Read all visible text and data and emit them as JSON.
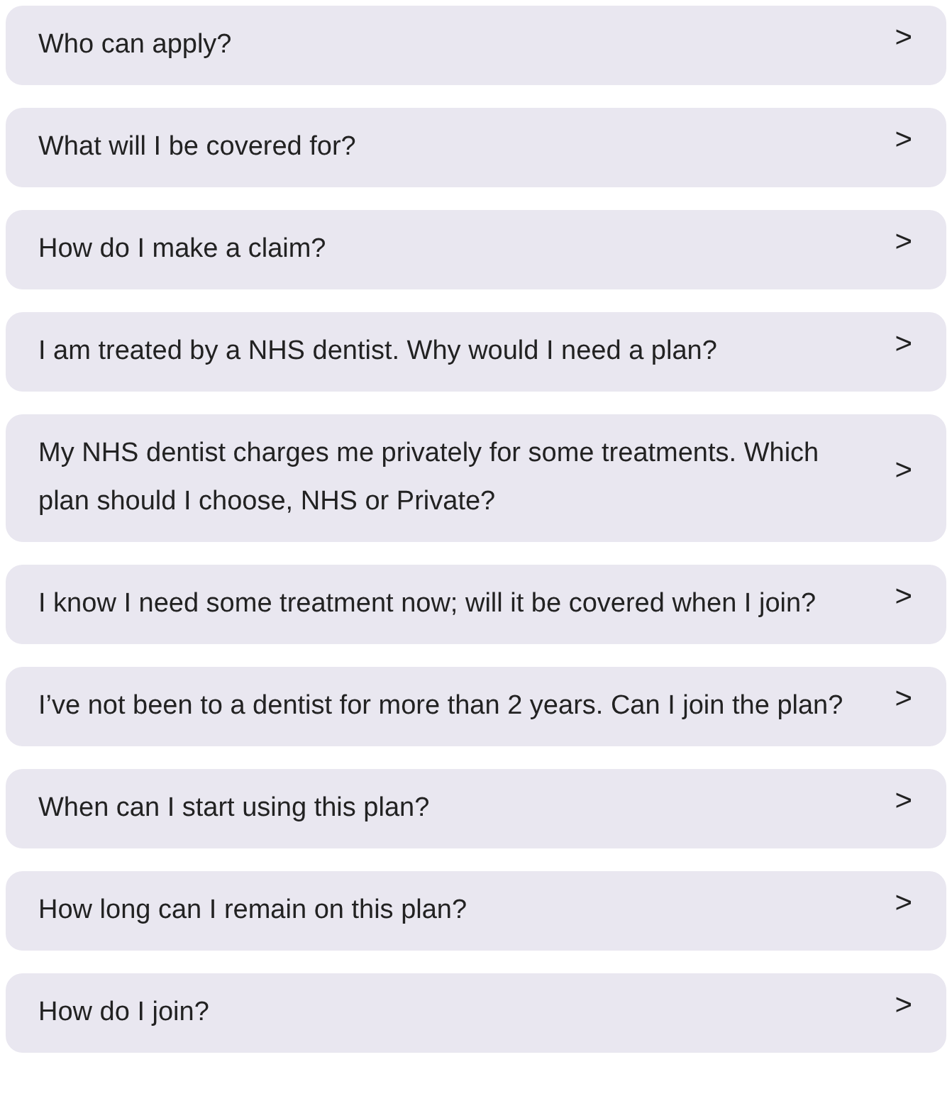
{
  "faq_items": [
    {
      "question": "Who can apply?",
      "chevron": ">"
    },
    {
      "question": "What will I be covered for?",
      "chevron": ">"
    },
    {
      "question": "How do I make a claim?",
      "chevron": ">"
    },
    {
      "question": "I am treated by a NHS dentist. Why would I need a plan?",
      "chevron": ">"
    },
    {
      "question": "My NHS dentist charges me privately for some treatments. Which plan should I choose, NHS or Private?",
      "chevron": ">"
    },
    {
      "question": "I know I need some treatment now; will it be covered when I join?",
      "chevron": ">"
    },
    {
      "question": "I’ve not been to a dentist for more than 2 years. Can I join the plan?",
      "chevron": ">"
    },
    {
      "question": "When can I start using this plan?",
      "chevron": ">"
    },
    {
      "question": "How long can I remain on this plan?",
      "chevron": ">"
    },
    {
      "question": "How do I join?",
      "chevron": ">"
    }
  ]
}
